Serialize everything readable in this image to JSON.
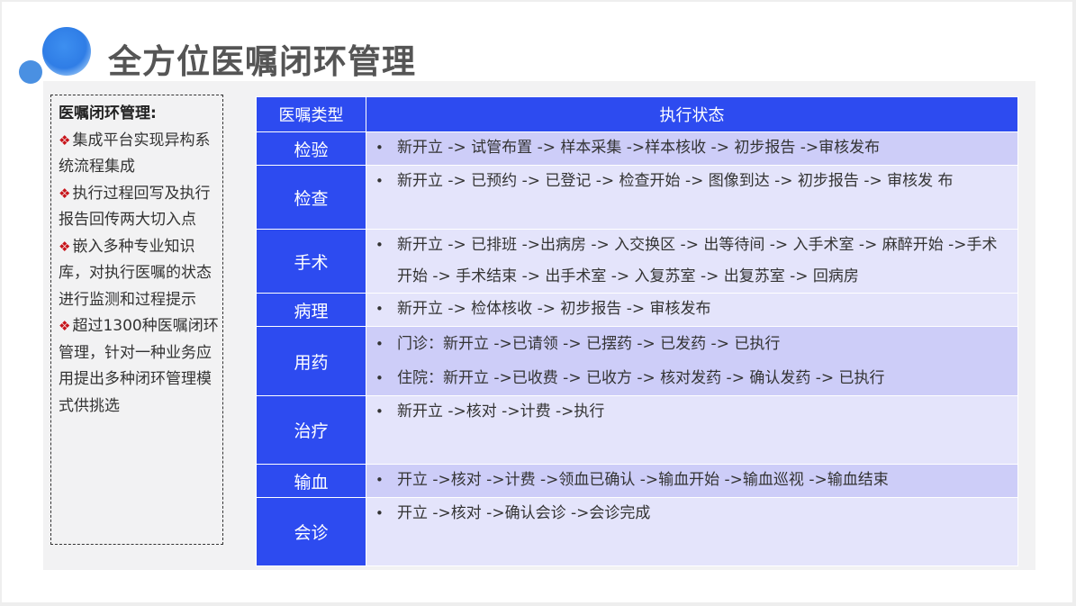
{
  "page": {
    "title": "全方位医嘱闭环管理"
  },
  "left_panel": {
    "heading": "医嘱闭环管理:",
    "bullet_symbol": "❖",
    "items": [
      "集成平台实现异构系统流程集成",
      "执行过程回写及执行报告回传两大切入点",
      "嵌入多种专业知识库，对执行医嘱的状态进行监测和过程提示",
      "超过1300种医嘱闭环管理，针对一种业务应用提出多种闭环管理模式供挑选"
    ]
  },
  "table": {
    "headers": [
      "医嘱类型",
      "执行状态"
    ],
    "bullet": "•",
    "rows": [
      {
        "type": "检验",
        "lines": [
          "新开立 -> 试管布置 -> 样本采集 ->样本核收 -> 初步报告 ->审核发布"
        ]
      },
      {
        "type": "检查",
        "lines": [
          "新开立 -> 已预约 -> 已登记 -> 检查开始 -> 图像到达 -> 初步报告 -> 审核发 布"
        ]
      },
      {
        "type": "手术",
        "lines": [
          "新开立 -> 已排班 ->出病房 -> 入交换区 -> 出等待间 -> 入手术室 -> 麻醉开始 ->手术开始 -> 手术结束 -> 出手术室 -> 入复苏室 -> 出复苏室 -> 回病房"
        ]
      },
      {
        "type": "病理",
        "lines": [
          "新开立 -> 检体核收 -> 初步报告 -> 审核发布"
        ]
      },
      {
        "type": "用药",
        "lines": [
          "门诊：新开立 ->已请领 -> 已摆药 -> 已发药 -> 已执行",
          "住院：新开立 ->已收费 -> 已收方 -> 核对发药 -> 确认发药 -> 已执行"
        ]
      },
      {
        "type": "治疗",
        "lines": [
          "新开立 ->核对 ->计费 ->执行"
        ]
      },
      {
        "type": "输血",
        "lines": [
          "开立 ->核对 ->计费 ->领血已确认 ->输血开始 ->输血巡视 ->输血结束"
        ]
      },
      {
        "type": "会诊",
        "lines": [
          "开立 ->核对 ->确认会诊 ->会诊完成"
        ]
      }
    ]
  },
  "colors": {
    "header_blue": "#2d4bf0",
    "row_light": "#e4e4fb",
    "row_dark": "#cdcdf8",
    "bullet_red": "#c8141a"
  }
}
